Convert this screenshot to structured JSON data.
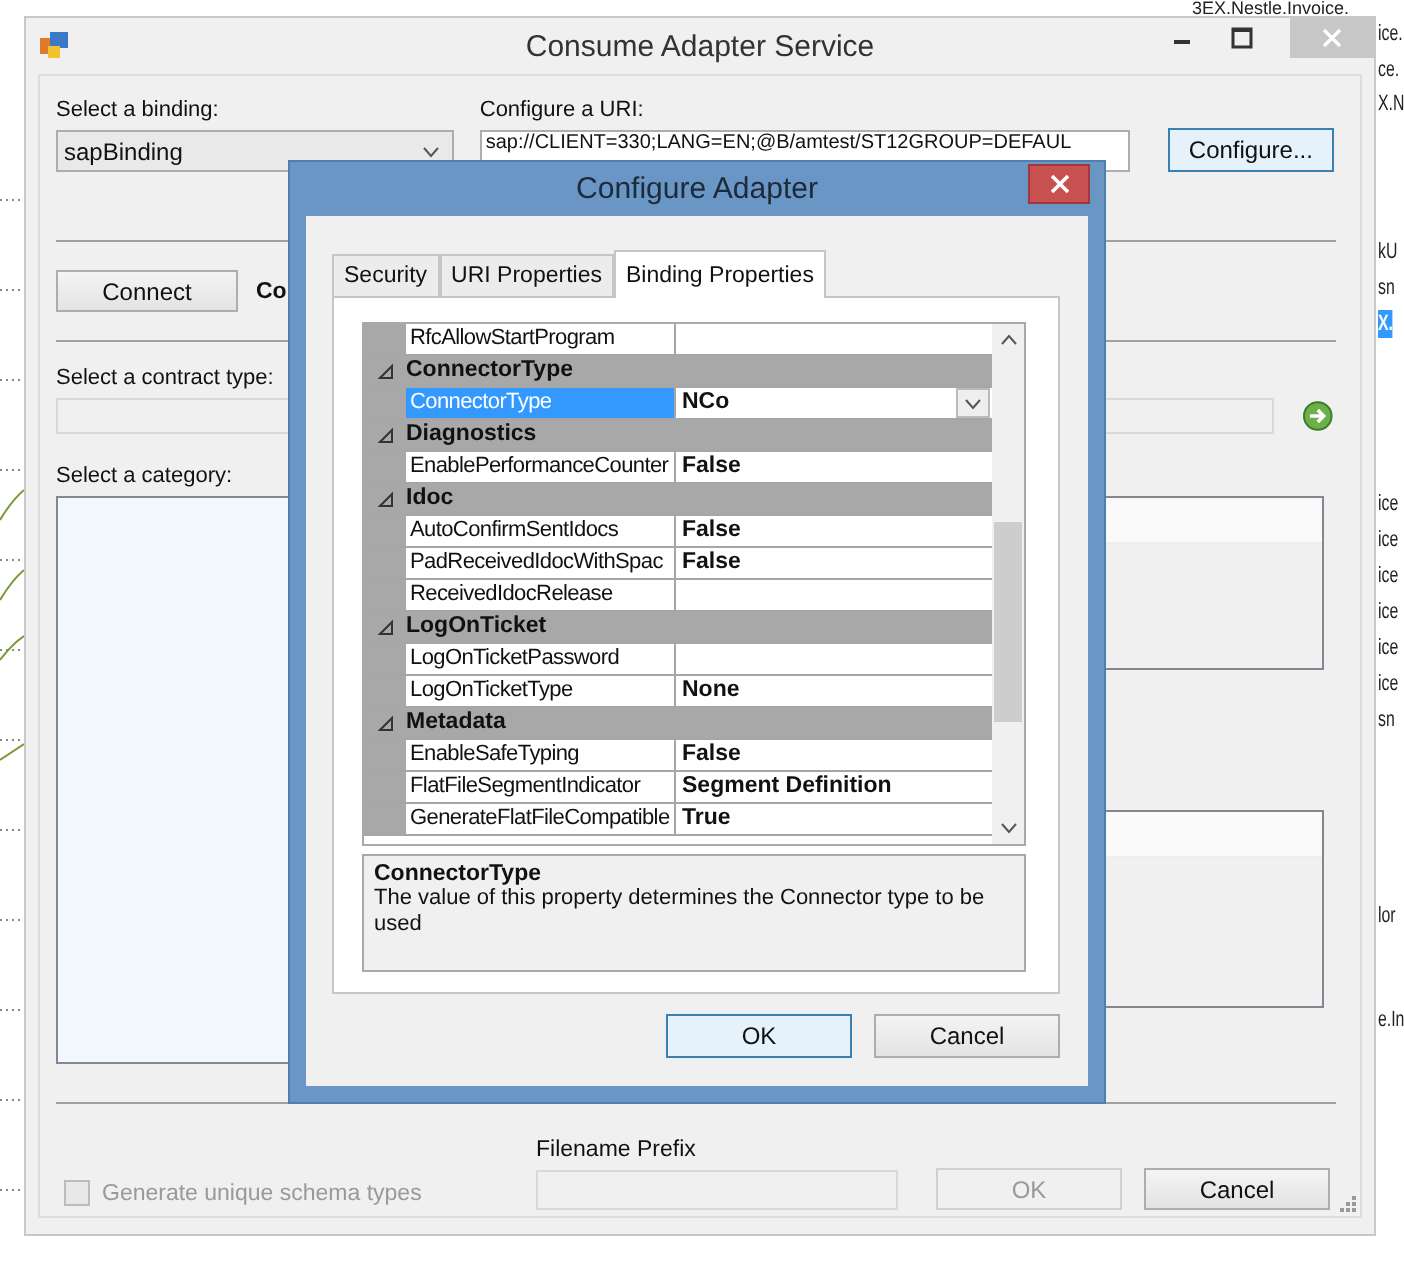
{
  "background": {
    "top_text": "3EX.Nestle.Invoice.",
    "side_texts": [
      {
        "text": "ice.",
        "selected": false
      },
      {
        "text": "ce.",
        "selected": false
      },
      {
        "text": "X.N",
        "selected": false
      },
      {
        "text": "kU",
        "selected": false
      },
      {
        "text": "sn",
        "selected": false
      },
      {
        "text": "X.",
        "selected": true
      },
      {
        "text": "ice",
        "selected": false
      },
      {
        "text": "ice",
        "selected": false
      },
      {
        "text": "ice",
        "selected": false
      },
      {
        "text": "ice",
        "selected": false
      },
      {
        "text": "ice",
        "selected": false
      },
      {
        "text": "ice",
        "selected": false
      },
      {
        "text": "sn",
        "selected": false
      },
      {
        "text": "lor",
        "selected": false
      },
      {
        "text": "e.In",
        "selected": false
      }
    ]
  },
  "window": {
    "title": "Consume Adapter Service",
    "binding": {
      "label": "Select a binding:",
      "value": "sapBinding"
    },
    "uri": {
      "label": "Configure a URI:",
      "value": "sap://CLIENT=330;LANG=EN;@B/amtest/ST12GROUP=DEFAUL"
    },
    "configure_button": "Configure...",
    "connect_button": "Connect",
    "status_text": "Co",
    "contract": {
      "label": "Select a contract type:",
      "disabled": true
    },
    "category": {
      "label": "Select a category:"
    },
    "generate_unique": {
      "label": "Generate unique schema types",
      "checked": false,
      "disabled": true
    },
    "filename_prefix": {
      "label": "Filename Prefix",
      "disabled": true
    },
    "buttons": [
      {
        "label": "OK",
        "disabled": true
      },
      {
        "label": "Cancel",
        "disabled": false
      }
    ]
  },
  "dialog": {
    "title": "Configure Adapter",
    "tabs": [
      {
        "label": "Security",
        "selected": false
      },
      {
        "label": "URI Properties",
        "selected": false
      },
      {
        "label": "Binding Properties",
        "selected": true
      }
    ],
    "properties": [
      {
        "kind": "property",
        "name": "RfcAllowStartProgram",
        "selected": false
      },
      {
        "kind": "category",
        "name": "ConnectorType",
        "expanded": true
      },
      {
        "kind": "property",
        "name": "ConnectorType",
        "value": "NCo",
        "selected": true
      },
      {
        "kind": "category",
        "name": "Diagnostics",
        "expanded": true
      },
      {
        "kind": "property",
        "name": "EnablePerformanceCounter",
        "value": "False",
        "selected": false
      },
      {
        "kind": "category",
        "name": "Idoc",
        "expanded": true
      },
      {
        "kind": "property",
        "name": "AutoConfirmSentIdocs",
        "value": "False",
        "selected": false
      },
      {
        "kind": "property",
        "name": "PadReceivedIdocWithSpac",
        "value": "False",
        "selected": false
      },
      {
        "kind": "property",
        "name": "ReceivedIdocRelease",
        "selected": false
      },
      {
        "kind": "category",
        "name": "LogOnTicket",
        "expanded": true
      },
      {
        "kind": "property",
        "name": "LogOnTicketPassword",
        "selected": false
      },
      {
        "kind": "property",
        "name": "LogOnTicketType",
        "value": "None",
        "selected": false
      },
      {
        "kind": "category",
        "name": "Metadata",
        "expanded": true
      },
      {
        "kind": "property",
        "name": "EnableSafeTyping",
        "value": "False",
        "selected": false
      },
      {
        "kind": "property",
        "name": "FlatFileSegmentIndicator",
        "value": "Segment Definition",
        "selected": false
      },
      {
        "kind": "property",
        "name": "GenerateFlatFileCompatible",
        "value": "True",
        "selected": false
      }
    ],
    "description": {
      "title": "ConnectorType",
      "text": "The value of this property determines the Connector type to be used"
    },
    "buttons": [
      {
        "label": "OK",
        "default": true
      },
      {
        "label": "Cancel",
        "default": false
      }
    ]
  }
}
